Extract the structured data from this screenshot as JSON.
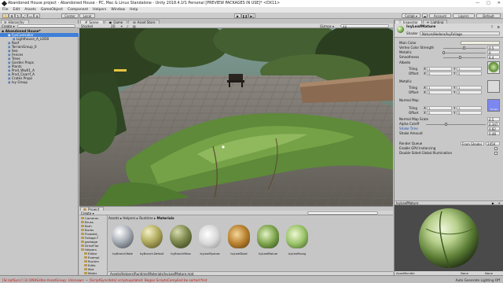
{
  "window": {
    "title": "Abandoned House project - Abandoned House - PC, Mac & Linux Standalone - Unity 2018.4.1f1 Personal [PREVIEW PACKAGES IN USE]* <DX11>",
    "controls": [
      "—",
      "□",
      "✕"
    ]
  },
  "menu": [
    "File",
    "Edit",
    "Assets",
    "GameObject",
    "Component",
    "Helpers",
    "Window",
    "Help"
  ],
  "toolbar": {
    "pivot": "Center",
    "space": "Local",
    "collab": "Collab ▾",
    "account": "Account",
    "layers": "Layers",
    "layout": "Default"
  },
  "hierarchy": {
    "tab": "Hierarchy",
    "create": "Create ▾",
    "scene": "Abandoned House*",
    "items": [
      {
        "label": "FpsController",
        "depth": 1,
        "selected": true
      },
      {
        "label": "Lighthouse_A_LOD0",
        "depth": 2,
        "selected": false
      },
      {
        "label": "Roof",
        "depth": 1,
        "selected": false
      },
      {
        "label": "TerrainGroup_0",
        "depth": 1,
        "selected": false
      },
      {
        "label": "Sea",
        "depth": 1,
        "selected": false
      },
      {
        "label": "Fences",
        "depth": 1,
        "selected": false
      },
      {
        "label": "Trees",
        "depth": 1,
        "selected": false
      },
      {
        "label": "Garden Props",
        "depth": 1,
        "selected": false
      },
      {
        "label": "Plants",
        "depth": 1,
        "selected": false
      },
      {
        "label": "Prxd_Ww01_A",
        "depth": 1,
        "selected": false
      },
      {
        "label": "Prxd_Caarrf_A",
        "depth": 1,
        "selected": false
      },
      {
        "label": "Crates Props",
        "depth": 1,
        "selected": false
      },
      {
        "label": "Ivy Group",
        "depth": 1,
        "selected": false
      }
    ]
  },
  "scene_view": {
    "tabs": [
      {
        "label": "Scene",
        "active": true
      },
      {
        "label": "Game",
        "active": false
      },
      {
        "label": "Asset Store",
        "active": false
      }
    ],
    "shading": "Shaded",
    "mode": "2D",
    "gizmos": "Gizmos ▾",
    "search": "All"
  },
  "project": {
    "tab": "Project",
    "create": "Create ▾",
    "tree": [
      "Cameras",
      "Bruss",
      "Brsh",
      "Burbs",
      "Flooded_",
      "Foliage F",
      "garbage",
      "DriveFlor",
      "Helpers",
      "Editor",
      "Exampl",
      "Runtim",
      "Edits",
      "Mat",
      "Mater"
    ],
    "breadcrumb": [
      "Assets",
      "Helpers",
      "Runtime",
      "Materials"
    ],
    "assets": [
      {
        "name": "IvyBranchTable",
        "kind": "grey"
      },
      {
        "name": "IvyBranch.Default",
        "kind": "olive"
      },
      {
        "name": "IvyBranchMoss",
        "kind": "moss"
      },
      {
        "name": "IvyLeafOpenes",
        "kind": "leafwhite"
      },
      {
        "name": "IvyLeafDead",
        "kind": "leafdead"
      },
      {
        "name": "IvyLeafMature",
        "kind": "leafmature"
      },
      {
        "name": "IvyLeafYoung",
        "kind": "leafyoung"
      }
    ],
    "path": "Assets/Helpers/Runtime/Materials/IvyLeafMature.mat"
  },
  "inspector": {
    "tabs": [
      {
        "label": "Inspector",
        "active": true
      },
      {
        "label": "Lighting",
        "active": false
      }
    ],
    "material_name": "IvyLeafMature",
    "shader_label": "Shader",
    "shader_value": "Nature/Hedera/IvyFoliage",
    "props": {
      "main_color": "Main Color",
      "vertex_color_strength": "Vertex Color Strength",
      "vertex_color_strength_value": "0.5",
      "metallic": "Metallic",
      "metallic_value": "0",
      "smoothness": "Smoothness",
      "smoothness_value": "0.4",
      "albedo": "Albedo",
      "metallic_map": "Metallic",
      "normal_map": "Normal Map",
      "tiling": "Tiling",
      "offset": "Offset",
      "x": "X",
      "y": "Y",
      "one": "1",
      "zero": "0",
      "normal_map_scale": "Normal Map Scale",
      "normal_map_scale_value": "0.5",
      "alpha_cutoff": "Alpha Cutoff",
      "alpha_cutoff_value": "0.347",
      "shake_time": "Shake Time",
      "shake_time_value": "0.82",
      "shake_amount": "Shake Amount",
      "shake_amount_value": "0.48",
      "render_queue": "Render Queue",
      "render_queue_mode": "From Shader",
      "render_queue_value": "2450",
      "gpu_instancing": "Enable GPU Instancing",
      "double_sided_gi": "Double Sided Global Illumination",
      "normal_map_thumb": "Bumpy"
    },
    "preview_title": "IvyLeafMature",
    "asset_bundle_label": "AssetBundle",
    "asset_bundle_value": "None",
    "asset_bundle_variant": "None"
  },
  "status": {
    "error": "[ScriptSync] (3) DNXEditor.AssetGroup: Unknown: ~ [ScriptSyncdata] scriptsupdated: Began ScriptsCompiled be sorted first",
    "right": "Auto Generate Lighting Off"
  },
  "colors": {
    "selection": "#3d7fd8",
    "error": "#c01818",
    "window_bg": "#c2c2c2"
  }
}
